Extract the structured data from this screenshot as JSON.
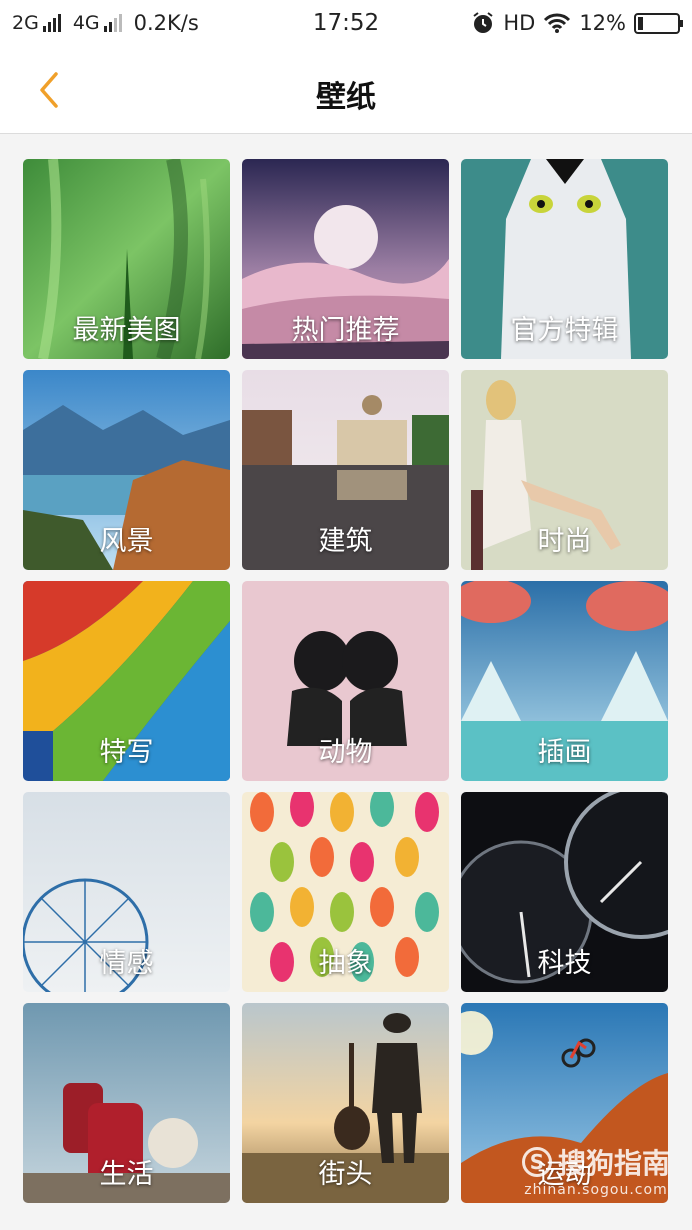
{
  "status_bar": {
    "net1": "2G",
    "net2": "4G",
    "speed": "0.2K/s",
    "time": "17:52",
    "hd": "HD",
    "battery": "12%",
    "battery_level": 0.12
  },
  "header": {
    "title": "壁纸"
  },
  "categories": [
    {
      "label": "最新美图"
    },
    {
      "label": "热门推荐"
    },
    {
      "label": "官方特辑"
    },
    {
      "label": "风景"
    },
    {
      "label": "建筑"
    },
    {
      "label": "时尚"
    },
    {
      "label": "特写"
    },
    {
      "label": "动物"
    },
    {
      "label": "插画"
    },
    {
      "label": "情感"
    },
    {
      "label": "抽象"
    },
    {
      "label": "科技"
    },
    {
      "label": "生活"
    },
    {
      "label": "街头"
    },
    {
      "label": "运动"
    }
  ],
  "watermark": {
    "brand": "搜狗指南",
    "url": "zhinan.sogou.com"
  },
  "colors": {
    "accent": "#f0a02a"
  }
}
